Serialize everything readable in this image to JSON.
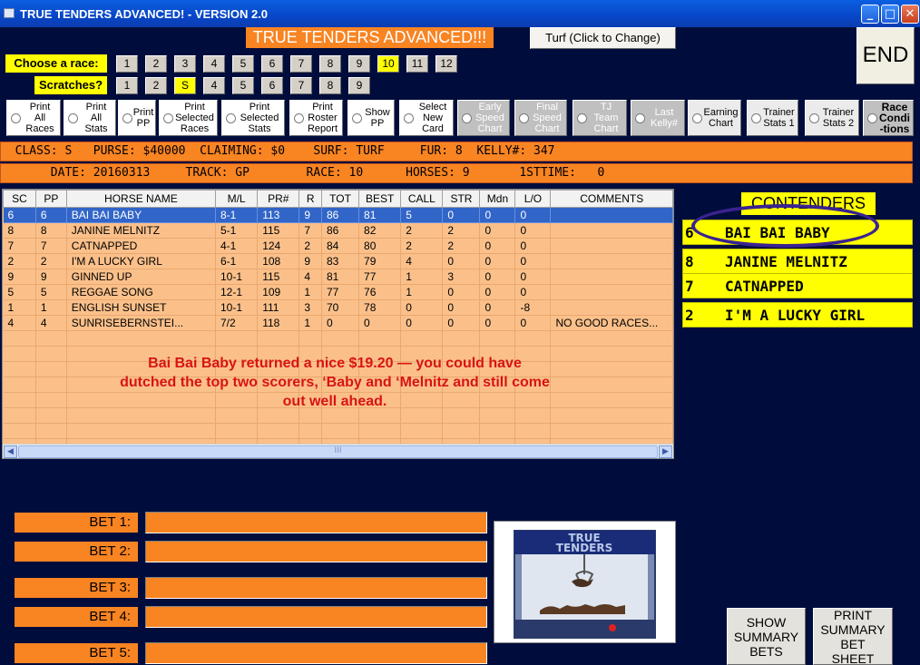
{
  "window": {
    "title": "TRUE TENDERS ADVANCED! - VERSION 2.0"
  },
  "header": {
    "title": "TRUE TENDERS ADVANCED!!!",
    "turf_button": "Turf (Click to Change)",
    "end_button": "END"
  },
  "race_select": {
    "label": "Choose  a race:",
    "buttons": [
      "1",
      "2",
      "3",
      "4",
      "5",
      "6",
      "7",
      "8",
      "9",
      "10",
      "11",
      "12"
    ],
    "selected": "10"
  },
  "scratches": {
    "label": "Scratches?",
    "buttons": [
      "1",
      "2",
      "S",
      "4",
      "5",
      "6",
      "7",
      "8",
      "9"
    ],
    "selected": "S"
  },
  "options": [
    "Print\nAll\nRaces",
    "Print\nAll\nStats",
    "Print\nPP",
    "Print\nSelected\nRaces",
    "Print\nSelected\nStats",
    "Print\nRoster\nReport",
    "Show\nPP",
    "Select\nNew\nCard",
    "Early\nSpeed\nChart",
    "Final\nSpeed\nChart",
    "TJ\nTeam\nChart",
    "Last\nKelly#",
    "Earning\nChart",
    "Trainer\nStats 1",
    "Trainer\nStats 2",
    "Race\nCondi\n-tions"
  ],
  "info1": "  CLASS: S   PURSE: $40000  CLAIMING: $0    SURF: TURF     FUR: 8  KELLY#: 347",
  "info2": "       DATE: 20160313     TRACK: GP        RACE: 10      HORSES: 9       1STTIME:   0",
  "grid": {
    "columns": [
      "SC",
      "PP",
      "HORSE NAME",
      "M/L",
      "PR#",
      "R",
      "TOT",
      "BEST",
      "CALL",
      "STR",
      "Mdn",
      "L/O",
      "COMMENTS"
    ],
    "rows": [
      [
        "6",
        "6",
        "BAI BAI BABY",
        "8-1",
        "113",
        "9",
        "86",
        "81",
        "5",
        "0",
        "0",
        "0",
        ""
      ],
      [
        "8",
        "8",
        "JANINE MELNITZ",
        "5-1",
        "115",
        "7",
        "86",
        "82",
        "2",
        "2",
        "0",
        "0",
        ""
      ],
      [
        "7",
        "7",
        "CATNAPPED",
        "4-1",
        "124",
        "2",
        "84",
        "80",
        "2",
        "2",
        "0",
        "0",
        ""
      ],
      [
        "2",
        "2",
        "I'M A LUCKY GIRL",
        "6-1",
        "108",
        "9",
        "83",
        "79",
        "4",
        "0",
        "0",
        "0",
        ""
      ],
      [
        "9",
        "9",
        "GINNED UP",
        "10-1",
        "115",
        "4",
        "81",
        "77",
        "1",
        "3",
        "0",
        "0",
        ""
      ],
      [
        "5",
        "5",
        "REGGAE SONG",
        "12-1",
        "109",
        "1",
        "77",
        "76",
        "1",
        "0",
        "0",
        "0",
        ""
      ],
      [
        "1",
        "1",
        "ENGLISH SUNSET",
        "10-1",
        "111",
        "3",
        "70",
        "78",
        "0",
        "0",
        "0",
        "-8",
        ""
      ],
      [
        "4",
        "4",
        "SUNRISEBERNSTEI...",
        "7/2",
        "118",
        "1",
        "0",
        "0",
        "0",
        "0",
        "0",
        "0",
        "NO GOOD RACES..."
      ]
    ],
    "scroll_grip": "III"
  },
  "note": "Bai Bai Baby returned a nice $19.20 — you could have dutched the top two scorers, ‘Baby and ‘Melnitz and still come out well ahead.",
  "contenders": {
    "label": "CONTENDERS",
    "items": [
      {
        "num": "6",
        "name": "BAI BAI BABY"
      },
      {
        "num": "8",
        "name": "JANINE MELNITZ"
      },
      {
        "num": "7",
        "name": "CATNAPPED"
      },
      {
        "num": "2",
        "name": "I'M A LUCKY GIRL"
      }
    ]
  },
  "bets": [
    "BET 1:",
    "BET 2:",
    "BET 3:",
    "BET 4:",
    "BET 5:"
  ],
  "logo_text": "TRUE TENDERS",
  "buttons": {
    "show_summary": "SHOW\nSUMMARY\nBETS",
    "print_summary": "PRINT\nSUMMARY\nBET\nSHEET"
  },
  "colors": {
    "background": "#000d3c",
    "orange": "#f98422",
    "yellow": "#ffff00",
    "selection": "#3165c8",
    "note": "#d81414"
  }
}
